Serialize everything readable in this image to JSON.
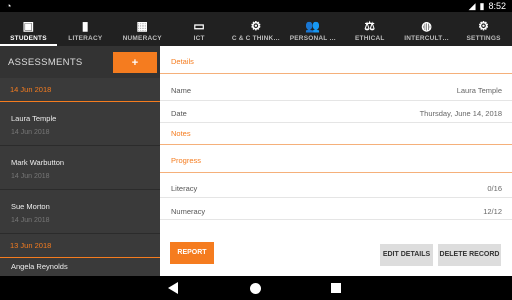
{
  "status_bar": {
    "time": "8:52"
  },
  "tabs": [
    {
      "label": "STUDENTS",
      "icon": "id-card-icon",
      "glyph": "▣",
      "active": true
    },
    {
      "label": "LITERACY",
      "icon": "book-icon",
      "glyph": "▮",
      "active": false
    },
    {
      "label": "NUMERACY",
      "icon": "calculator-icon",
      "glyph": "▦",
      "active": false
    },
    {
      "label": "ICT",
      "icon": "monitor-icon",
      "glyph": "▭",
      "active": false
    },
    {
      "label": "C & C THINK…",
      "icon": "gears-icon",
      "glyph": "⚙",
      "active": false
    },
    {
      "label": "PERSONAL …",
      "icon": "people-icon",
      "glyph": "👥",
      "active": false
    },
    {
      "label": "ETHICAL",
      "icon": "scales-icon",
      "glyph": "⚖",
      "active": false
    },
    {
      "label": "INTERCULT…",
      "icon": "globe-icon",
      "glyph": "◍",
      "active": false
    },
    {
      "label": "SETTINGS",
      "icon": "gear-icon",
      "glyph": "⚙",
      "active": false
    }
  ],
  "sidebar": {
    "title": "ASSESSMENTS",
    "add_label": "+",
    "date_1": "14 Jun 2018",
    "people_1": [
      {
        "name": "Laura Temple",
        "date": "14 Jun 2018"
      },
      {
        "name": "Mark Warbutton",
        "date": "14 Jun 2018"
      },
      {
        "name": "Sue Morton",
        "date": "14 Jun 2018"
      }
    ],
    "date_2": "13 Jun 2018",
    "people_2": [
      {
        "name": "Angela Reynolds",
        "date": ""
      }
    ]
  },
  "main": {
    "details_label": "Details",
    "name_label": "Name",
    "name_value": "Laura Temple",
    "date_label": "Date",
    "date_value": "Thursday, June 14, 2018",
    "notes_label": "Notes",
    "progress_label": "Progress",
    "literacy_label": "Literacy",
    "literacy_value": "0/16",
    "numeracy_label": "Numeracy",
    "numeracy_value": "12/12",
    "report_button": "REPORT",
    "edit_button": "EDIT DETAILS",
    "delete_button": "DELETE RECORD"
  },
  "colors": {
    "accent": "#f57c1f",
    "tabbar": "#212121",
    "sidebar": "#3a3a3a"
  }
}
